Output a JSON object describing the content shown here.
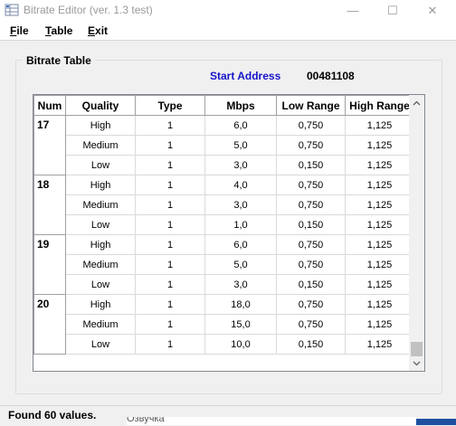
{
  "window": {
    "title": "Bitrate Editor (ver. 1.3 test)",
    "minimize_icon": "minimize-icon",
    "maximize_icon": "maximize-icon",
    "close_icon": "close-icon"
  },
  "menu": [
    {
      "label": "File",
      "mnemonic": "F",
      "rest": "ile"
    },
    {
      "label": "Table",
      "mnemonic": "T",
      "rest": "able"
    },
    {
      "label": "Exit",
      "mnemonic": "E",
      "rest": "xit"
    }
  ],
  "group": {
    "label": "Bitrate Table",
    "start_address_label": "Start Address",
    "start_address_value": "00481108"
  },
  "table": {
    "headers": [
      "Num",
      "Quality",
      "Type",
      "Mbps",
      "Low Range",
      "High Range"
    ],
    "groups": [
      {
        "num": "17",
        "rows": [
          {
            "quality": "High",
            "type": "1",
            "mbps": "6,0",
            "low": "0,750",
            "high": "1,125"
          },
          {
            "quality": "Medium",
            "type": "1",
            "mbps": "5,0",
            "low": "0,750",
            "high": "1,125"
          },
          {
            "quality": "Low",
            "type": "1",
            "mbps": "3,0",
            "low": "0,150",
            "high": "1,125"
          }
        ]
      },
      {
        "num": "18",
        "rows": [
          {
            "quality": "High",
            "type": "1",
            "mbps": "4,0",
            "low": "0,750",
            "high": "1,125"
          },
          {
            "quality": "Medium",
            "type": "1",
            "mbps": "3,0",
            "low": "0,750",
            "high": "1,125"
          },
          {
            "quality": "Low",
            "type": "1",
            "mbps": "1,0",
            "low": "0,150",
            "high": "1,125"
          }
        ]
      },
      {
        "num": "19",
        "rows": [
          {
            "quality": "High",
            "type": "1",
            "mbps": "6,0",
            "low": "0,750",
            "high": "1,125"
          },
          {
            "quality": "Medium",
            "type": "1",
            "mbps": "5,0",
            "low": "0,750",
            "high": "1,125"
          },
          {
            "quality": "Low",
            "type": "1",
            "mbps": "3,0",
            "low": "0,150",
            "high": "1,125"
          }
        ]
      },
      {
        "num": "20",
        "rows": [
          {
            "quality": "High",
            "type": "1",
            "mbps": "18,0",
            "low": "0,750",
            "high": "1,125"
          },
          {
            "quality": "Medium",
            "type": "1",
            "mbps": "15,0",
            "low": "0,750",
            "high": "1,125"
          },
          {
            "quality": "Low",
            "type": "1",
            "mbps": "10,0",
            "low": "0,150",
            "high": "1,125"
          }
        ]
      }
    ]
  },
  "status": {
    "text": "Found 60 values."
  },
  "background": {
    "partial_text": "Озвучка"
  }
}
